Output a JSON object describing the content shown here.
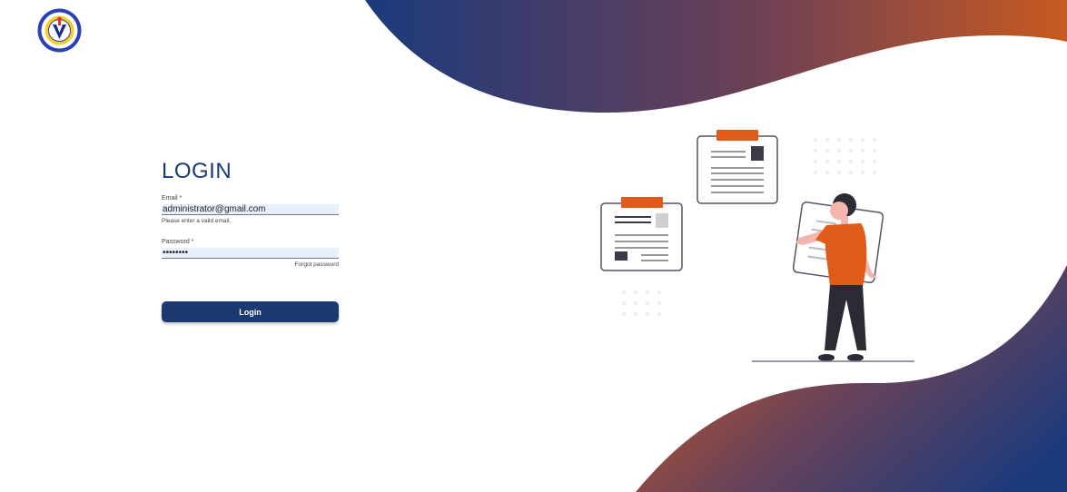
{
  "colors": {
    "primary": "#1b3a72",
    "accent": "#e05a1a",
    "input_fill": "#e8f0fe"
  },
  "logo": {
    "name": "university-seal-logo"
  },
  "login": {
    "title": "LOGIN",
    "email": {
      "label": "Email *",
      "value": "administrator@gmail.com",
      "hint": "Please enter a valid email."
    },
    "password": {
      "label": "Password *",
      "value": "••••••••"
    },
    "forgot_password": "Forgot password",
    "submit_label": "Login"
  },
  "illustration": {
    "name": "person-with-documents-illustration"
  }
}
